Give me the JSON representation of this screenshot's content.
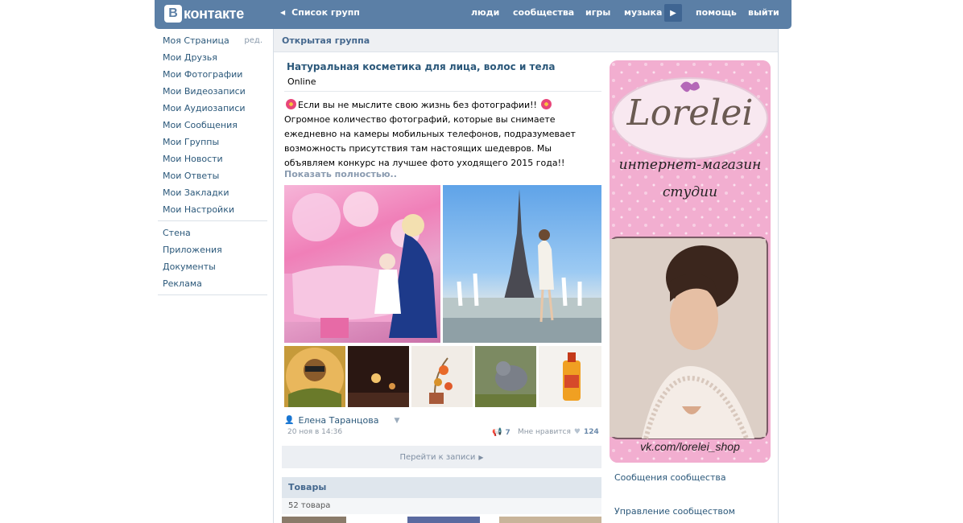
{
  "topbar": {
    "logo_text": "контакте",
    "logo_letter": "В",
    "back_label": "Список групп",
    "nav": [
      "люди",
      "сообщества",
      "игры",
      "музыка",
      "помощь",
      "выйти"
    ],
    "colors": {
      "bar": "#5b7fa6",
      "link": "#2b587a"
    }
  },
  "sidebar": {
    "edit_label": "ред.",
    "items": [
      "Моя Страница",
      "Мои Друзья",
      "Мои Фотографии",
      "Мои Видеозаписи",
      "Мои Аудиозаписи",
      "Мои Сообщения",
      "Мои Группы",
      "Мои Новости",
      "Мои Ответы",
      "Мои Закладки",
      "Мои Настройки"
    ],
    "extra": [
      "Стена",
      "Приложения",
      "Документы",
      "Реклама"
    ]
  },
  "group": {
    "header": "Открытая группа",
    "title": "Натуральная косметика для лица, волос и тела",
    "status": "Online"
  },
  "post": {
    "line1": "Если вы не мыслите свою жизнь без фотографии!!",
    "body": "Огромное количество фотографий, которые вы снимаете ежедневно на камеры мобильных телефонов, подразумевает возможность присутствия там настоящих шедевров. Мы объявляем конкурс на лучшее фото уходящего 2015 года!!",
    "show_more": "Показать полностью..",
    "author": "Елена Таранцова",
    "date": "20 ноя в 14:36",
    "reposts": "7",
    "likes_label": "Мне нравится",
    "likes": "124",
    "goto": "Перейти к записи"
  },
  "goods": {
    "header": "Товары",
    "count": "52 товара"
  },
  "banner": {
    "brand": "Lorelei",
    "line1": "интернет-магазин",
    "line2": "студии",
    "url": "vk.com/lorelei_shop"
  },
  "side_links": {
    "messages": "Сообщения сообщества",
    "manage": "Управление сообществом"
  }
}
